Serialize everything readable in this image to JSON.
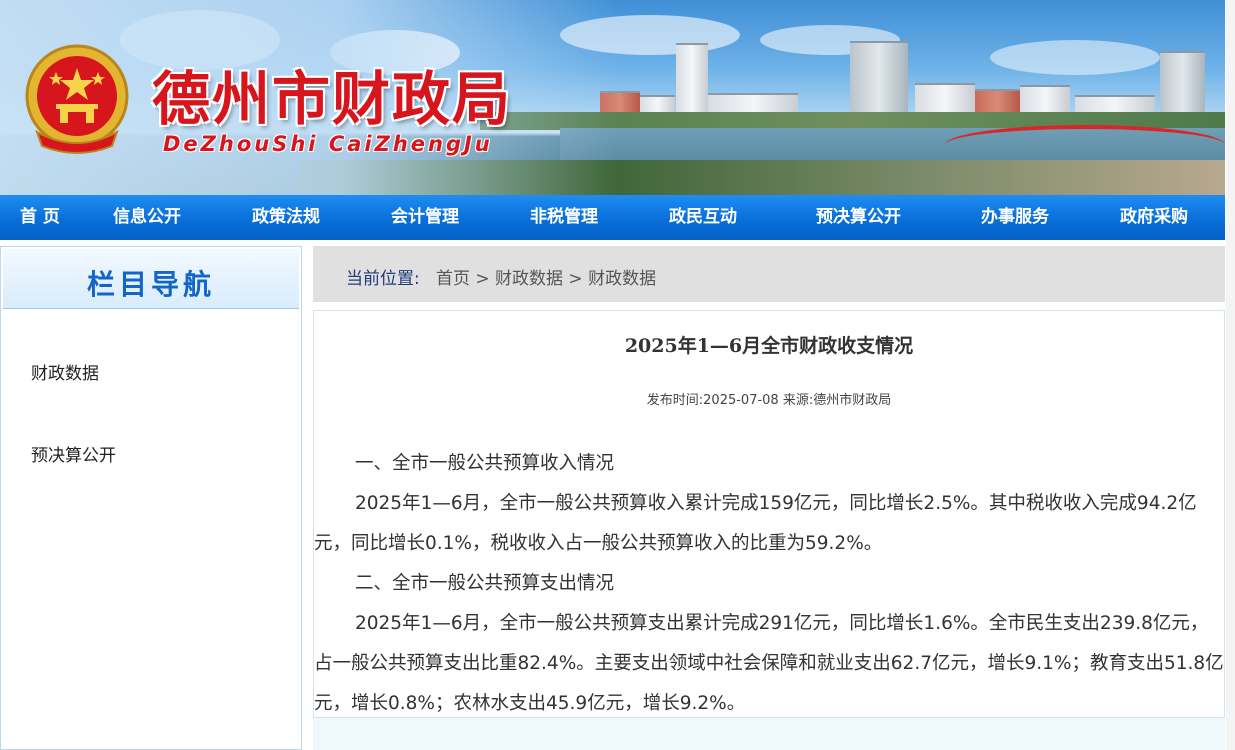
{
  "header": {
    "title": "德州市财政局",
    "pinyin": "DeZhouShi  CaiZhengJu"
  },
  "nav": [
    "首 页",
    "信息公开",
    "政策法规",
    "会计管理",
    "非税管理",
    "政民互动",
    "预决算公开",
    "办事服务",
    "政府采购"
  ],
  "sidebar": {
    "title": "栏目导航",
    "items": [
      "财政数据",
      "预决算公开"
    ]
  },
  "breadcrumb": {
    "label": "当前位置:",
    "items": [
      "首页",
      "财政数据",
      "财政数据"
    ],
    "separator": " > "
  },
  "article": {
    "title": "2025年1—6月全市财政收支情况",
    "meta": "发布时间:2025-07-08 来源:德州市财政局",
    "paragraphs": [
      "一、全市一般公共预算收入情况",
      "2025年1—6月，全市一般公共预算收入累计完成159亿元，同比增长2.5%。其中税收收入完成94.2亿元，同比增长0.1%，税收收入占一般公共预算收入的比重为59.2%。",
      "二、全市一般公共预算支出情况",
      "2025年1—6月，全市一般公共预算支出累计完成291亿元，同比增长1.6%。全市民生支出239.8亿元，占一般公共预算支出比重82.4%。主要支出领域中社会保障和就业支出62.7亿元，增长9.1%；教育支出51.8亿元，增长0.8%；农林水支出45.9亿元，增长9.2%。"
    ]
  },
  "colors": {
    "nav_bg": "#0a6fd9",
    "title_red": "#d6161c",
    "sidebar_title": "#1366c9",
    "crumb_bg": "#e0e0e0"
  },
  "icons": [
    "national-emblem-icon"
  ]
}
